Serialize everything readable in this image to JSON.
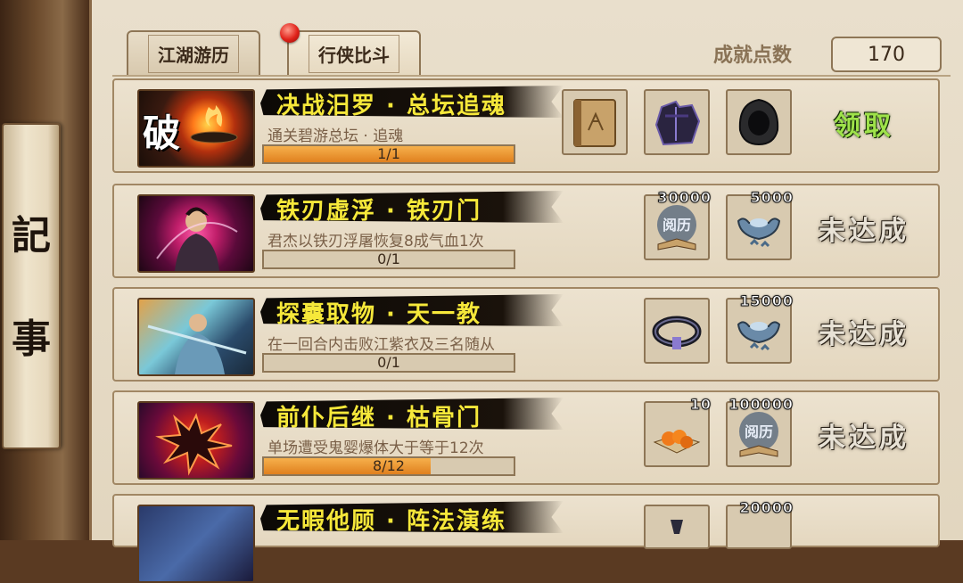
{
  "sidebar": {
    "chars": [
      "記",
      "事"
    ]
  },
  "tabs": [
    {
      "label": "江湖游历",
      "active": false
    },
    {
      "label": "行侠比斗",
      "active": true
    }
  ],
  "achievement": {
    "label": "成就点数",
    "value": "170"
  },
  "rows": [
    {
      "title": "决战汨罗 · 总坛追魂",
      "desc": "通关碧游总坛 · 追魂",
      "progress": "1/1",
      "fill": 1.0,
      "portrait_badge": "破",
      "rewards": [
        {
          "icon": "book-icon",
          "qty": ""
        },
        {
          "icon": "armor-icon",
          "qty": ""
        },
        {
          "icon": "hood-icon",
          "qty": ""
        }
      ],
      "claim": "领取",
      "claimable": true
    },
    {
      "title": "铁刃虚浮 · 铁刃门",
      "desc": "君杰以铁刃浮屠恢复8成气血1次",
      "progress": "0/1",
      "fill": 0.0,
      "portrait_badge": "",
      "rewards": [
        {
          "icon": "experience-book-icon",
          "qty": "30000"
        },
        {
          "icon": "silver-ingot-icon",
          "qty": "5000"
        }
      ],
      "claim": "未达成",
      "claimable": false
    },
    {
      "title": "探囊取物 · 天一教",
      "desc": "在一回合内击败江紫衣及三名随从",
      "progress": "0/1",
      "fill": 0.0,
      "portrait_badge": "",
      "rewards": [
        {
          "icon": "belt-icon",
          "qty": ""
        },
        {
          "icon": "silver-ingot-icon",
          "qty": "15000"
        }
      ],
      "claim": "未达成",
      "claimable": false
    },
    {
      "title": "前仆后继 · 枯骨门",
      "desc": "单场遭受鬼婴爆体大于等于12次",
      "progress": "8/12",
      "fill": 0.6667,
      "portrait_badge": "",
      "rewards": [
        {
          "icon": "oranges-icon",
          "qty": "10"
        },
        {
          "icon": "experience-book-icon",
          "qty": "100000"
        }
      ],
      "claim": "未达成",
      "claimable": false
    },
    {
      "title": "无暇他顾 · 阵法演练",
      "desc": "",
      "progress": "",
      "fill": 0.0,
      "portrait_badge": "",
      "rewards": [
        {
          "icon": "scroll-icon",
          "qty": ""
        },
        {
          "icon": "silver-ingot-icon",
          "qty": "20000"
        }
      ],
      "claim": "",
      "claimable": false
    }
  ],
  "colors": {
    "title_yellow": "#f6e83a",
    "progress_orange": "#e0801e",
    "claim_green": "#9ee24a"
  }
}
